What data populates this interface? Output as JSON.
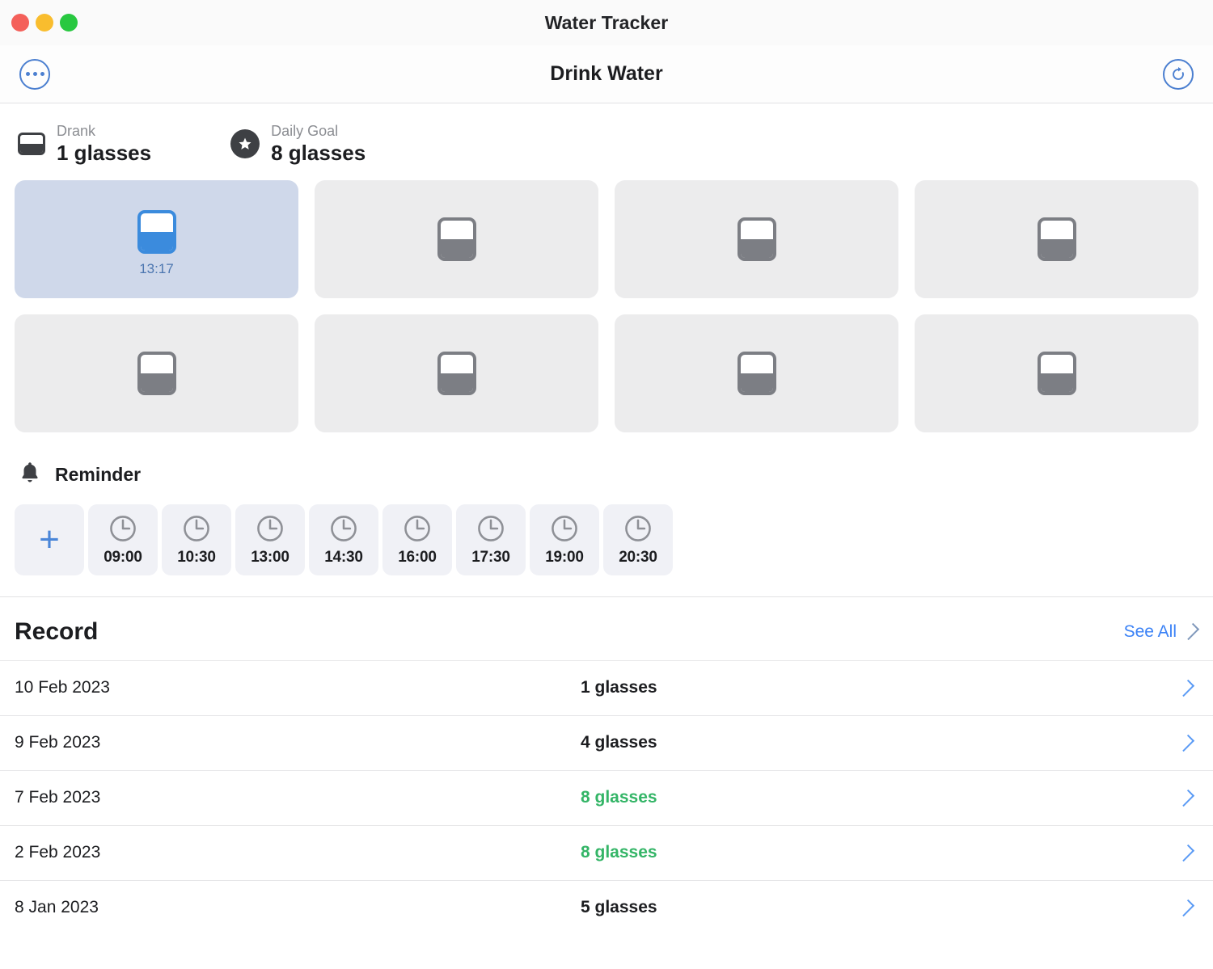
{
  "window": {
    "title": "Water Tracker",
    "traffic_lights": [
      "close",
      "minimize",
      "zoom"
    ]
  },
  "toolbar": {
    "title": "Drink Water",
    "more_icon": "ellipsis-circle-icon",
    "refresh_icon": "refresh-circle-icon"
  },
  "stats": {
    "drank": {
      "label": "Drank",
      "value": "1 glasses",
      "icon": "glass-half-icon"
    },
    "daily_goal": {
      "label": "Daily Goal",
      "value": "8 glasses",
      "icon": "star-badge-icon"
    }
  },
  "glasses": [
    {
      "filled": true,
      "time": "13:17"
    },
    {
      "filled": false,
      "time": ""
    },
    {
      "filled": false,
      "time": ""
    },
    {
      "filled": false,
      "time": ""
    },
    {
      "filled": false,
      "time": ""
    },
    {
      "filled": false,
      "time": ""
    },
    {
      "filled": false,
      "time": ""
    },
    {
      "filled": false,
      "time": ""
    }
  ],
  "reminder": {
    "title": "Reminder",
    "bell_icon": "bell-icon",
    "add_label": "+",
    "times": [
      "09:00",
      "10:30",
      "13:00",
      "14:30",
      "16:00",
      "17:30",
      "19:00",
      "20:30"
    ]
  },
  "record": {
    "title": "Record",
    "see_all_label": "See All",
    "rows": [
      {
        "date": "10 Feb 2023",
        "amount": "1 glasses",
        "goal_met": false
      },
      {
        "date": "9 Feb 2023",
        "amount": "4 glasses",
        "goal_met": false
      },
      {
        "date": "7 Feb 2023",
        "amount": "8 glasses",
        "goal_met": true
      },
      {
        "date": "2 Feb 2023",
        "amount": "8 glasses",
        "goal_met": true
      },
      {
        "date": "8 Jan 2023",
        "amount": "5 glasses",
        "goal_met": false
      }
    ]
  },
  "colors": {
    "accent_blue": "#3b82f6",
    "goal_green": "#34b567",
    "selected_card": "#cfd8ea",
    "card_gray": "#ececed",
    "chip_gray": "#f0f1f6"
  }
}
